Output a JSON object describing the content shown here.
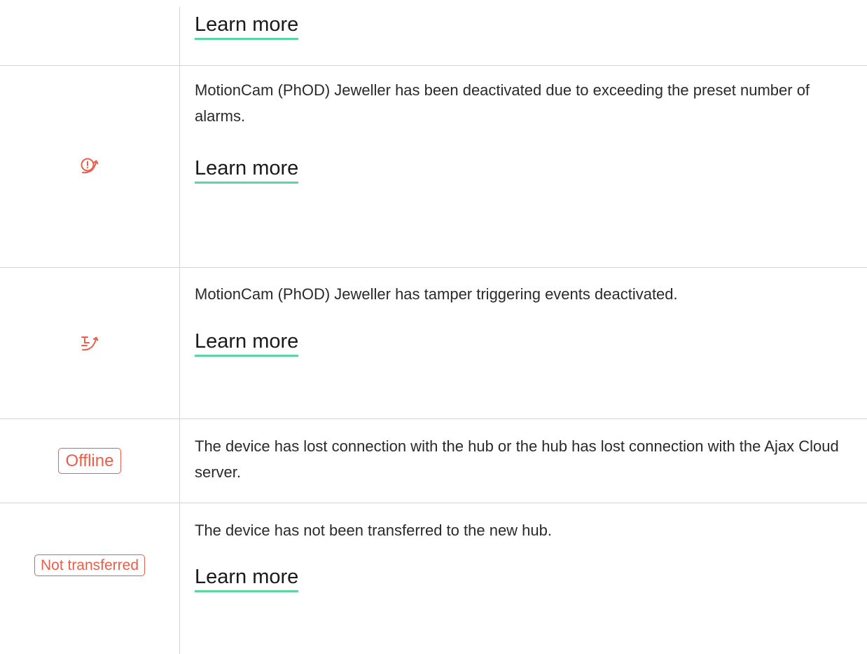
{
  "colors": {
    "accent_underline": "#5cd6a0",
    "status_red": "#e8604c",
    "divider": "#d4d4d4"
  },
  "rows": [
    {
      "learn_more": "Learn more"
    },
    {
      "icon": "alarm-limit-deactivated-icon",
      "description": "MotionCam (PhOD) Jeweller has been deactivated due to exceeding the preset number of alarms.",
      "learn_more": "Learn more"
    },
    {
      "icon": "tamper-deactivated-icon",
      "description": "MotionCam (PhOD) Jeweller has tamper triggering events deactivated.",
      "learn_more": "Learn more"
    },
    {
      "badge": "Offline",
      "description": "The device has lost connection with the hub or the hub has lost connection with the Ajax Cloud server."
    },
    {
      "badge": "Not transferred",
      "description": "The device has not been transferred to the new hub.",
      "learn_more": "Learn more"
    }
  ]
}
